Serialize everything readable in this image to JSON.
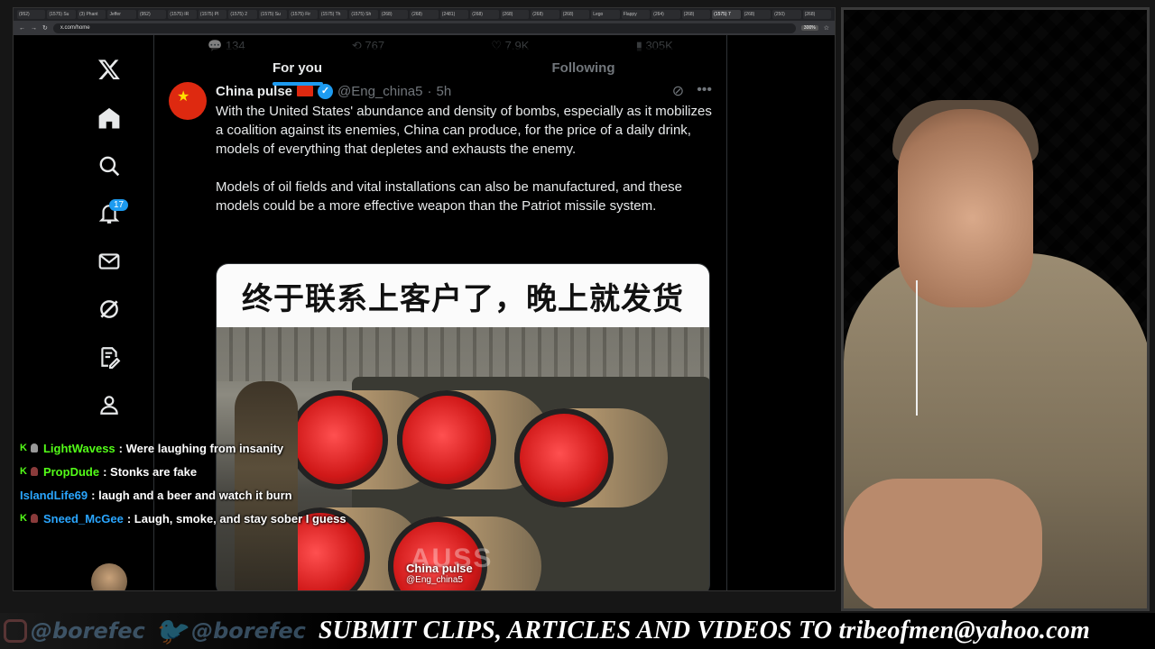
{
  "browser": {
    "tabs": [
      "(952)",
      "(1575) Su",
      "(3) Phant",
      "Jeffer",
      "(952)",
      "(1575) IR",
      "(1575) PI",
      "(1575) 2 ",
      "(1575) Su",
      "(1575) Fir",
      "(1575) Th",
      "(1575) Sh",
      "(268)",
      "(268)",
      "(2481)",
      "(268)",
      "(268)",
      "(268)",
      "(268)",
      "Lego",
      "Flappy",
      "(264)",
      "(268)",
      "(1575) 7",
      "(268)",
      "(250)",
      "(268)"
    ],
    "active_tab_index": 23,
    "url": "x.com/home",
    "zoom": "300%"
  },
  "nav": {
    "icons": [
      "x-logo-icon",
      "home-icon",
      "search-icon",
      "bell-icon",
      "mail-icon",
      "grok-icon",
      "edit-icon",
      "profile-icon"
    ],
    "notification_count": "17"
  },
  "timeline": {
    "tabs": [
      {
        "label": "For you",
        "active": true
      },
      {
        "label": "Following",
        "active": false
      }
    ],
    "prev_actions": {
      "replies": "134",
      "reposts": "767",
      "likes": "7.9K",
      "views": "305K"
    }
  },
  "tweet": {
    "name": "China pulse",
    "handle": "@Eng_china5",
    "time": "5h",
    "paragraphs": [
      "With the United States' abundance and density of bombs, especially as it mobilizes a coalition against its enemies, China can produce, for the price of a daily drink, models of everything that depletes and exhausts the enemy.",
      "Models of oil fields and vital installations can also be manufactured, and these models could be a more effective weapon than the Patriot missile system."
    ],
    "media_caption": "终于联系上客户了，晚上就发货",
    "media_watermark": "China pulse",
    "media_watermark_handle": "@Eng_china5",
    "media_ghost_text": "AUSS"
  },
  "chat": [
    {
      "user": "LightWavess",
      "msg": ": Were laughing from insanity",
      "color": "#53fc18",
      "badges": true
    },
    {
      "user": "PropDude",
      "msg": ": Stonks are fake",
      "color": "#53fc18",
      "badges": true
    },
    {
      "user": "IslandLife69",
      "msg": ": laugh and a beer and watch it burn",
      "color": "#2aa6ff",
      "badges": false
    },
    {
      "user": "Sneed_McGee",
      "msg": ": Laugh, smoke, and stay sober I guess",
      "color": "#2aa6ff",
      "badges": true
    }
  ],
  "banner": {
    "instagram": "@borefec",
    "twitter": "@borefec",
    "submit": "SUBMIT CLIPS, ARTICLES AND VIDEOS TO tribeofmen@yahoo.com"
  }
}
